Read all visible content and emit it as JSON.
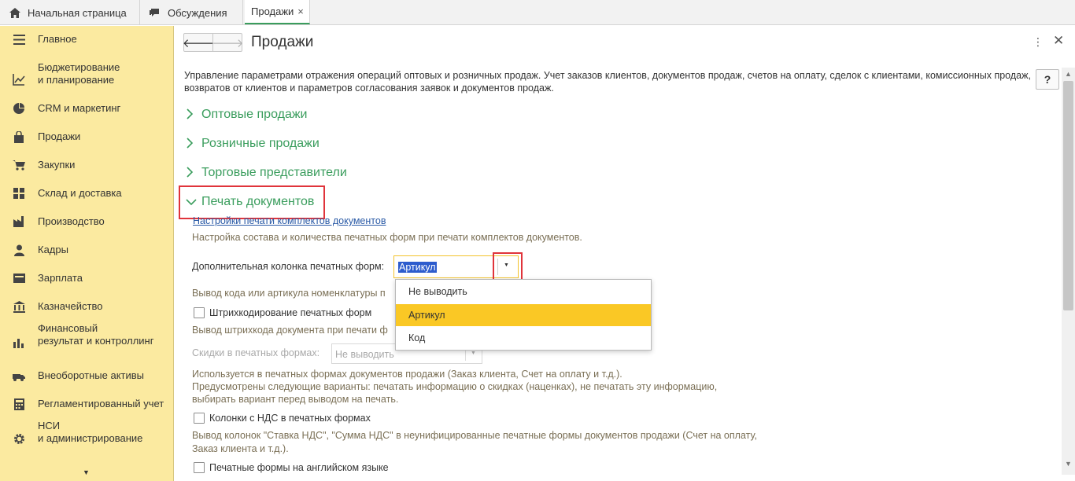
{
  "tabs": [
    {
      "label": "Начальная страница",
      "icon": "home-icon"
    },
    {
      "label": "Обсуждения",
      "icon": "chat-icon"
    },
    {
      "label": "Продажи",
      "close": "×"
    }
  ],
  "sidebar": {
    "items": [
      {
        "label": "Главное",
        "icon": "menu-icon"
      },
      {
        "label": "Бюджетирование\nи планирование",
        "icon": "budget-icon"
      },
      {
        "label": "CRM и маркетинг",
        "icon": "crm-icon"
      },
      {
        "label": "Продажи",
        "icon": "sales-bag-icon"
      },
      {
        "label": "Закупки",
        "icon": "cart-icon"
      },
      {
        "label": "Склад и доставка",
        "icon": "warehouse-icon"
      },
      {
        "label": "Производство",
        "icon": "factory-icon"
      },
      {
        "label": "Кадры",
        "icon": "person-icon"
      },
      {
        "label": "Зарплата",
        "icon": "salary-icon"
      },
      {
        "label": "Казначейство",
        "icon": "treasury-icon"
      },
      {
        "label": "Финансовый\nрезультат и контроллинг",
        "icon": "chart-icon"
      },
      {
        "label": "Внеоборотные активы",
        "icon": "assets-icon"
      },
      {
        "label": "Регламентированный учет",
        "icon": "accounting-icon"
      },
      {
        "label": "НСИ\nи администрирование",
        "icon": "gear-icon"
      }
    ],
    "more_arrow": "▼"
  },
  "header": {
    "back": "🡐",
    "forward": "🡒",
    "title": "Продажи",
    "more": "⋮",
    "close": "✕"
  },
  "description": "Управление параметрами отражения операций оптовых и розничных продаж. Учет заказов клиентов, документов продаж, счетов на оплату, сделок с клиентами, комиссионных продаж, возвратов от клиентов и параметров согласования заявок и документов продаж.",
  "help": "?",
  "sections": [
    {
      "title": "Оптовые продажи",
      "expanded": false
    },
    {
      "title": "Розничные продажи",
      "expanded": false
    },
    {
      "title": "Торговые представители",
      "expanded": false
    },
    {
      "title": "Печать документов",
      "expanded": true
    }
  ],
  "print": {
    "kit_link": "Настройки печати комплектов документов",
    "kit_note": "Настройка состава и количества печатных форм при печати комплектов документов.",
    "extra_column_label": "Дополнительная колонка печатных форм:",
    "extra_column_value": "Артикул",
    "extra_column_note": "Вывод кода или артикула номенклатуры п",
    "dropdown_options": [
      "Не выводить",
      "Артикул",
      "Код"
    ],
    "dropdown_selected": "Артикул",
    "barcode_checkbox": "Штрихкодирование печатных форм",
    "barcode_checked": false,
    "barcode_note": "Вывод штрихкода документа при печати ф",
    "discounts_label": "Скидки в печатных формах:",
    "discounts_value": "Не выводить",
    "discounts_note_1": "Используется в печатных формах документов продажи (Заказ клиента, Счет на оплату и т.д.).",
    "discounts_note_2": "Предусмотрены следующие варианты: печатать информацию о скидках (наценках), не печатать эту информацию,",
    "discounts_note_3": "выбирать вариант перед выводом на печать.",
    "vat_checkbox": "Колонки с НДС в печатных формах",
    "vat_checked": false,
    "vat_note_1": "Вывод колонок \"Ставка НДС\", \"Сумма НДС\" в неунифицированные печатные формы документов продажи (Счет на оплату,",
    "vat_note_2": "Заказ клиента и т.д.).",
    "english_checkbox": "Печатные формы на английском языке",
    "english_checked": false
  },
  "colors": {
    "accent_green": "#3a9d5d",
    "sidebar_bg": "#fbeaa0",
    "highlight_red": "#e0343b",
    "selection_yellow": "#fac825"
  }
}
